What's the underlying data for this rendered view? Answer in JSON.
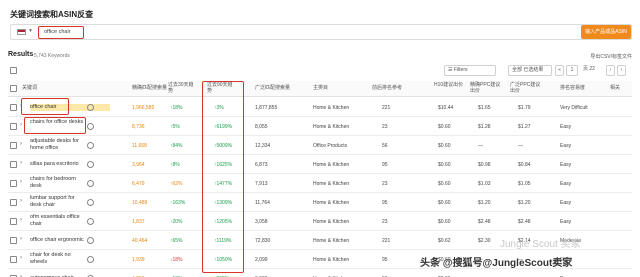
{
  "title": "关键词搜索和ASIN反查",
  "search": {
    "value": "office chair",
    "button_label": "输入产品或品ASIN"
  },
  "results": {
    "label": "Results",
    "count": "5,743 Keywords",
    "export": "导出CSV/标签文件"
  },
  "controls": {
    "filters": "Filters",
    "group": "全部 已选结果",
    "page": "1",
    "pages": "页 22"
  },
  "columns": [
    "关键词",
    "精确匹配搜索量",
    "过去30天趋势",
    "过去90天趋势",
    "广泛匹配搜索量",
    "主类目",
    "前后排名参考",
    "H10建议出价",
    "精确PPC建议出价",
    "广泛PPC建议出价",
    "排名容易度",
    "相关"
  ],
  "rows": [
    {
      "keyword": "office chair",
      "exact": "1,966,585",
      "t30": "↑18%",
      "t30c": "up",
      "t90": "↑3%",
      "broad": "1,877,855",
      "cat": "Home & Kitchen",
      "rank": "221",
      "h10": "$10.44",
      "ppc_exact": "$1.65",
      "ppc_broad": "$1.79",
      "ease": "Very Difficult",
      "hl": true
    },
    {
      "keyword": "chairs for office desks",
      "exact": "8,736",
      "t30": "↑5%",
      "t30c": "up",
      "t90": "↑6199%",
      "broad": "8,055",
      "cat": "Home & Kitchen",
      "rank": "23",
      "h10": "$0.60",
      "ppc_exact": "$1.28",
      "ppc_broad": "$1.27",
      "ease": "Easy",
      "hl": false
    },
    {
      "keyword": "adjustable desks for home office",
      "exact": "11,658",
      "t30": "↑84%",
      "t30c": "up",
      "t90": "↑5009%",
      "broad": "12,334",
      "cat": "Office Products",
      "rank": "56",
      "h10": "$0.60",
      "ppc_exact": "—",
      "ppc_broad": "—",
      "ease": "Easy",
      "hl": false
    },
    {
      "keyword": "sillas para escritorio",
      "exact": "3,964",
      "t30": "↑8%",
      "t30c": "up",
      "t90": "↑1625%",
      "broad": "6,873",
      "cat": "Home & Kitchen",
      "rank": "95",
      "h10": "$0.60",
      "ppc_exact": "$0.98",
      "ppc_broad": "$0.84",
      "ease": "Easy",
      "hl": false
    },
    {
      "keyword": "chairs for bedroom desk",
      "exact": "6,479",
      "t30": "↑62%",
      "t30c": "orange",
      "t90": "↑1477%",
      "broad": "7,913",
      "cat": "Home & Kitchen",
      "rank": "23",
      "h10": "$0.60",
      "ppc_exact": "$1.03",
      "ppc_broad": "$1.05",
      "ease": "Easy",
      "hl": false
    },
    {
      "keyword": "lumbar support for desk chair",
      "exact": "10,489",
      "t30": "↑163%",
      "t30c": "up",
      "t90": "↑1309%",
      "broad": "11,764",
      "cat": "Home & Kitchen",
      "rank": "95",
      "h10": "$0.60",
      "ppc_exact": "$1.20",
      "ppc_broad": "$1.20",
      "ease": "Easy",
      "hl": false
    },
    {
      "keyword": "ofm essentials office chair",
      "exact": "1,837",
      "t30": "↑20%",
      "t30c": "up",
      "t90": "↑1205%",
      "broad": "3,058",
      "cat": "Home & Kitchen",
      "rank": "23",
      "h10": "$0.60",
      "ppc_exact": "$2.48",
      "ppc_broad": "$2.48",
      "ease": "Easy",
      "hl": false
    },
    {
      "keyword": "office chair ergonomic",
      "exact": "40,464",
      "t30": "↑65%",
      "t30c": "up",
      "t90": "↑1119%",
      "broad": "72,830",
      "cat": "Home & Kitchen",
      "rank": "221",
      "h10": "$0.62",
      "ppc_exact": "$2.30",
      "ppc_broad": "$2.14",
      "ease": "Moderate",
      "hl": false
    },
    {
      "keyword": "chair for desk no wheels",
      "exact": "1,939",
      "t30": "↓18%",
      "t30c": "down",
      "t90": "↑1050%",
      "broad": "2,099",
      "cat": "Home & Kitchen",
      "rank": "95",
      "h10": "$0.60",
      "ppc_exact": "—",
      "ppc_broad": "—",
      "ease": "Easy",
      "hl": false
    },
    {
      "keyword": "autonomous chair",
      "exact": "4,259",
      "t30": "↑13%",
      "t30c": "up",
      "t90": "↑902%",
      "broad": "6,999",
      "cat": "Home & Kitchen",
      "rank": "56",
      "h10": "$0.60",
      "ppc_exact": "—",
      "ppc_broad": "—",
      "ease": "Easy",
      "hl": false
    }
  ],
  "watermark": "头条 @搜狐号@JungleScout卖家",
  "watermark_faint": "Jungle Scout 卖家",
  "colors": {
    "accent": "#f08a1c",
    "highlight_box": "#d9342b",
    "up": "#1a9c4a",
    "down": "#d33a3a"
  }
}
